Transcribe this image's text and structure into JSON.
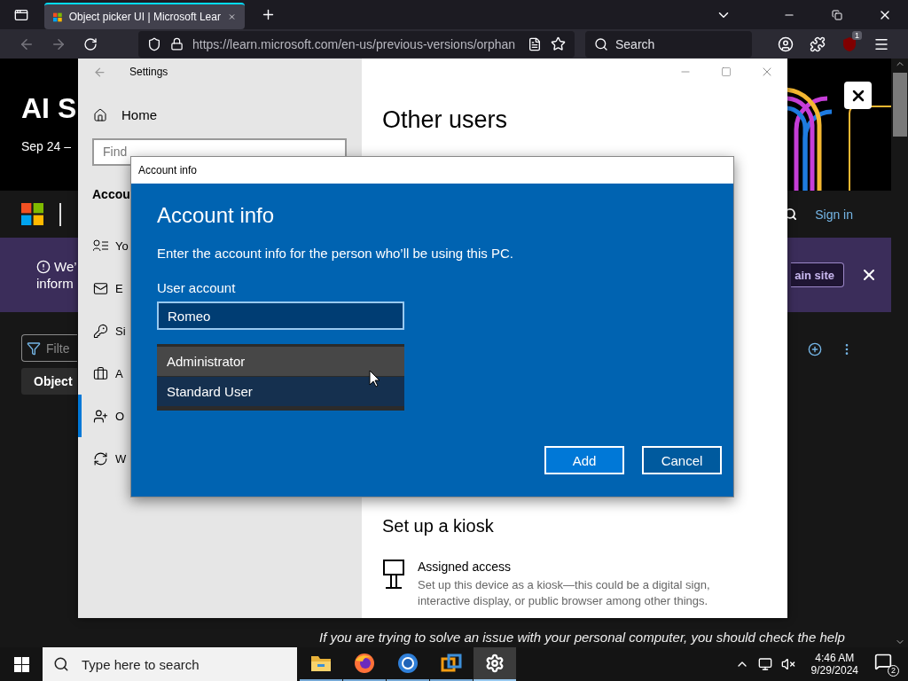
{
  "browser": {
    "tabs": [
      {
        "title": "Object picker UI | Microsoft Lear",
        "selected": true
      }
    ],
    "url": "https://learn.microsoft.com/en-us/previous-versions/orphan",
    "search_placeholder": "Search",
    "extension_badge": "1"
  },
  "page": {
    "hero": {
      "title": "AI S",
      "date": "Sep 24 –"
    },
    "nav": {
      "sign_in": "Sign in"
    },
    "banner": {
      "line_1": "We’",
      "line_2": "inform",
      "button": "ain site"
    },
    "filter": {
      "placeholder": "Filte"
    },
    "tab": "Object",
    "footer_text": "If you are trying to solve an issue with your personal computer, you should check the help"
  },
  "settings": {
    "title": "Settings",
    "home": "Home",
    "search_placeholder": "Find",
    "section": "Accou",
    "nav_items": [
      {
        "label": "Yo",
        "selected": false
      },
      {
        "label": "E",
        "selected": false
      },
      {
        "label": "Si",
        "selected": false
      },
      {
        "label": "A",
        "selected": false
      },
      {
        "label": "O",
        "selected": true
      },
      {
        "label": "W",
        "selected": false
      }
    ],
    "heading": "Other users",
    "kiosk": {
      "heading": "Set up a kiosk",
      "title": "Assigned access",
      "description": "Set up this device as a kiosk—this could be a digital sign, interactive display, or public browser among other things."
    }
  },
  "dialog": {
    "window_title": "Account info",
    "heading": "Account info",
    "description": "Enter the account info for the person who’ll be using this PC.",
    "field_label": "User account",
    "field_value": "Romeo",
    "account_types": [
      {
        "label": "Administrator",
        "highlighted": true,
        "selected": false
      },
      {
        "label": "Standard User",
        "highlighted": false,
        "selected": true
      }
    ],
    "buttons": [
      {
        "label": "Add",
        "kind": "primary"
      },
      {
        "label": "Cancel",
        "kind": "secondary"
      }
    ]
  },
  "taskbar": {
    "search_placeholder": "Type here to search",
    "apps": [
      {
        "kind": "explorer",
        "active": false
      },
      {
        "kind": "firefox",
        "active": false
      },
      {
        "kind": "chromium",
        "active": false
      },
      {
        "kind": "vmware",
        "active": false
      },
      {
        "kind": "settings",
        "active": true
      }
    ],
    "time": "4:46 AM",
    "date": "9/29/2024",
    "notification_count": "2"
  }
}
